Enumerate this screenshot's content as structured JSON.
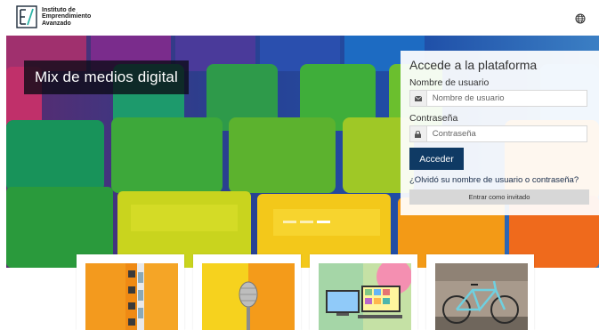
{
  "header": {
    "logo_line1": "Instituto de",
    "logo_line2": "Emprendimiento",
    "logo_line3": "Avanzado",
    "language_icon": "globe-icon"
  },
  "hero": {
    "caption": "Mix de medios digital",
    "slides_total": 3,
    "active_slide": 3
  },
  "login": {
    "title": "Accede a la plataforma",
    "username_label": "Nombre de usuario",
    "username_placeholder": "Nombre de usuario",
    "username_icon": "envelope-icon",
    "password_label": "Contraseña",
    "password_placeholder": "Contraseña",
    "password_icon": "lock-icon",
    "submit_label": "Acceder",
    "forgot_link": "¿Olvidó su nombre de usuario o contraseña?",
    "guest_label": "Entrar como invitado"
  },
  "cards": [
    {
      "image": "orange-building"
    },
    {
      "image": "microphone"
    },
    {
      "image": "video-call-screens"
    },
    {
      "image": "bicycle-wall"
    }
  ],
  "colors": {
    "primary_button": "#0f3a64",
    "guest_button": "#d7d7d7",
    "caption_bg": "#0a0a14"
  }
}
